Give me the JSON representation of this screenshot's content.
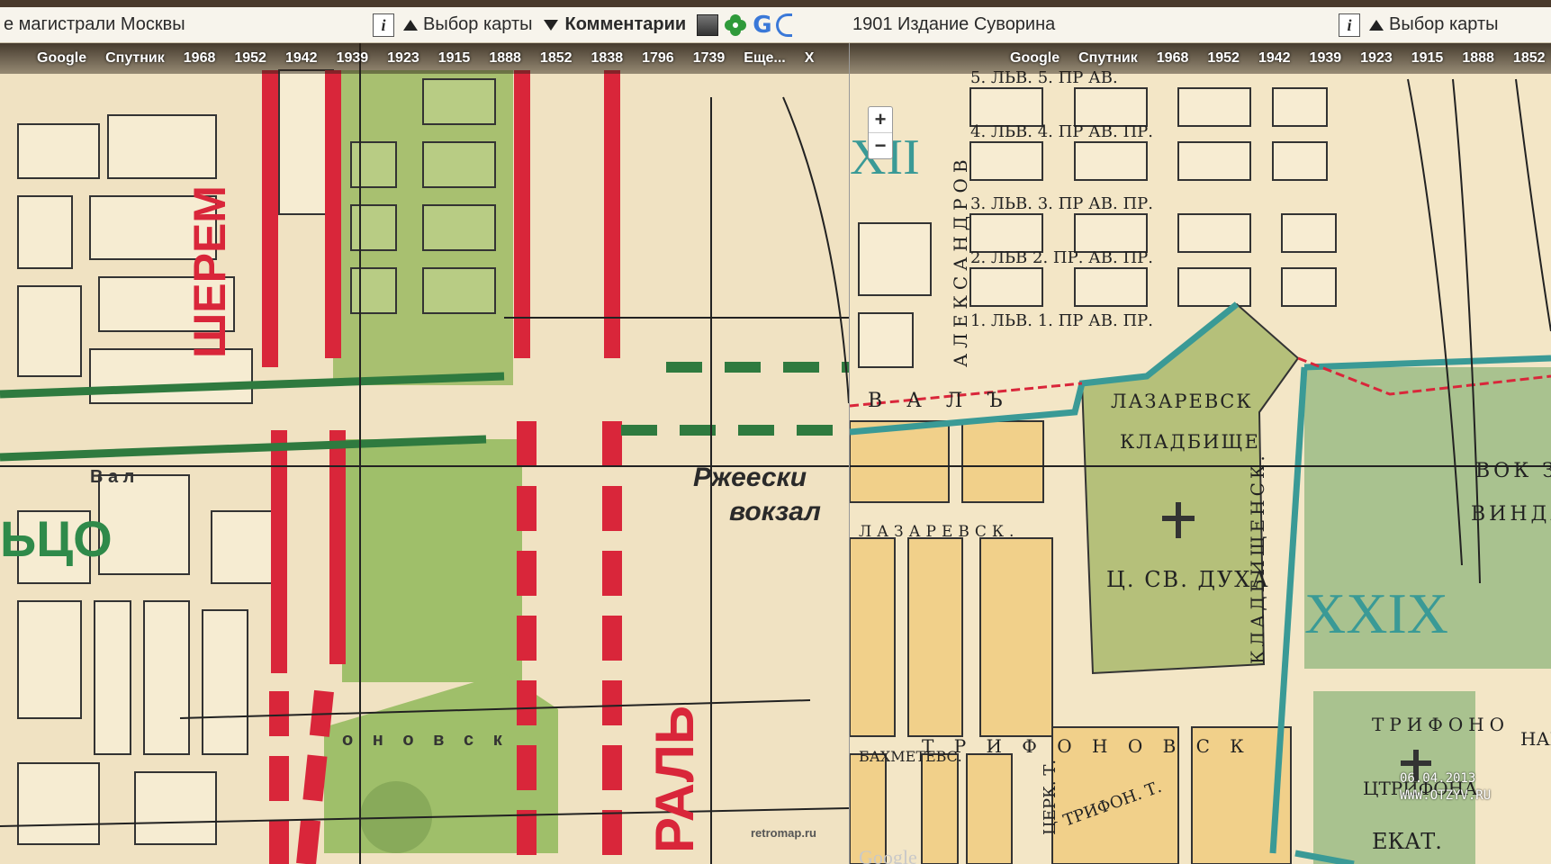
{
  "left_panel": {
    "title": "е магистрали Москвы",
    "map_select_label": "Выбор карты",
    "comments_label": "Комментарии",
    "info_label": "i",
    "g_icon_label": "G",
    "layers": [
      "Google",
      "Спутник",
      "1968",
      "1952",
      "1942",
      "1939",
      "1923",
      "1915",
      "1888",
      "1852",
      "1838",
      "1796",
      "1739",
      "Еще...",
      "X"
    ],
    "map_labels": {
      "station_line1": "Ржеески",
      "station_line2": "вокзал",
      "source": "retromap.ru",
      "vertical_1": "ШЕРЕМ",
      "vertical_2": "РАЛЬ",
      "green_label": "ЬЦО",
      "street_a": "В а л",
      "street_b": "о н о в с к"
    }
  },
  "right_panel": {
    "title": "1901 Издание Суворина",
    "map_select_label": "Выбор карты",
    "info_label": "i",
    "layers": [
      "Google",
      "Спутник",
      "1968",
      "1952",
      "1942",
      "1939",
      "1923",
      "1915",
      "1888",
      "1852"
    ],
    "zoom_in": "+",
    "zoom_out": "−",
    "map_labels": {
      "district_a": "XII",
      "district_b": "XXIX",
      "cemetery_1": "ЛАЗАРЕВСК",
      "cemetery_2": "КЛАДБИЩЕ",
      "church": "Ц. СВ. ДУХА",
      "trifona": "ЦТРИФОНА",
      "ekat": "ЕКАТ.",
      "val": "В А Л Ъ",
      "lazarevsk_per": "ЛАЗАРЕВСК.",
      "bakhmetev": "БАХМЕТЕВС.",
      "trifonovsk": "Т Р И Ф О Н О В С К",
      "trifon_t": "ТРИФОН. Т.",
      "trifono": "ТРИФОНО",
      "vok": "ВОК З",
      "vinda": "ВИНДА",
      "kladbishch": "КЛАДБИЩЕНСК.",
      "aleksandrov": "АЛЕКСАНДРОВ",
      "tserk": "ЦЕРК. Т.",
      "nap": "НАП",
      "row1": "5. ЛЬВ.  5. ПР  АВ.",
      "row2": "4. ЛЬВ.   4. ПР   АВ.   ПР.",
      "row3": "3. ЛЬВ.   3. ПР   АВ.   ПР.",
      "row4": "2. ЛЬВ   2. ПР.   АВ.   ПР.",
      "row5": "1. ЛЬВ.   1. ПР   АВ.   ПР.",
      "google_wm": "Google"
    },
    "watermark_date": "06.04.2013",
    "watermark_site": "WWW.OTZYV.RU"
  },
  "colors": {
    "park_green": "#9fbf6a",
    "red_line": "#d9263a",
    "dark_green": "#2f7a3f",
    "orange_block": "#f1d08a",
    "teal": "#3a9a96"
  }
}
